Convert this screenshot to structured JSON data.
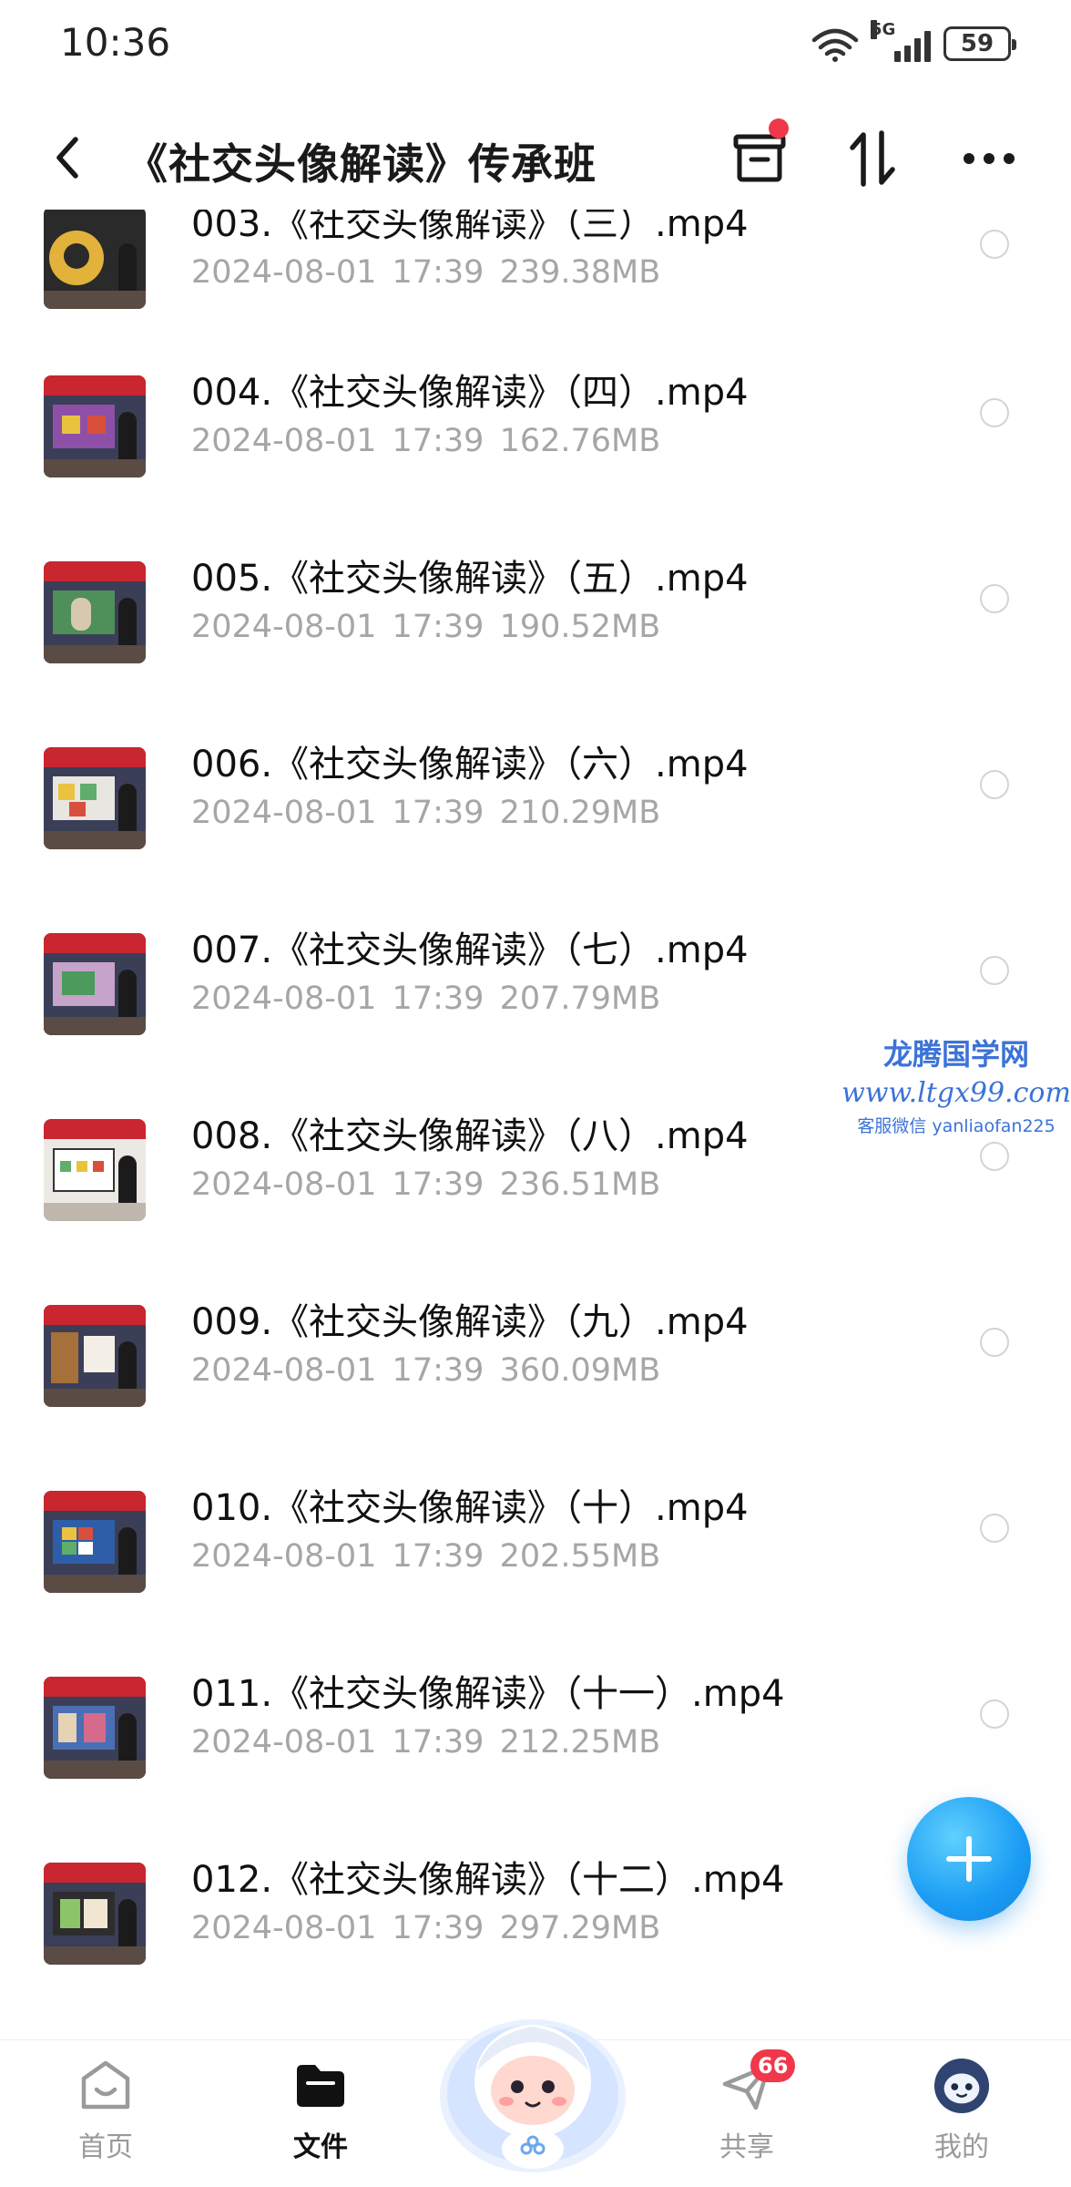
{
  "status_bar": {
    "time": "10:36",
    "network": "5G",
    "battery": "59"
  },
  "header": {
    "title": "《社交头像解读》传承班"
  },
  "files": [
    {
      "name": "003.《社交头像解读》（三）.mp4",
      "date": "2024-08-01",
      "time": "17:39",
      "size": "239.38MB"
    },
    {
      "name": "004.《社交头像解读》（四）.mp4",
      "date": "2024-08-01",
      "time": "17:39",
      "size": "162.76MB"
    },
    {
      "name": "005.《社交头像解读》（五）.mp4",
      "date": "2024-08-01",
      "time": "17:39",
      "size": "190.52MB"
    },
    {
      "name": "006.《社交头像解读》（六）.mp4",
      "date": "2024-08-01",
      "time": "17:39",
      "size": "210.29MB"
    },
    {
      "name": "007.《社交头像解读》（七）.mp4",
      "date": "2024-08-01",
      "time": "17:39",
      "size": "207.79MB"
    },
    {
      "name": "008.《社交头像解读》（八）.mp4",
      "date": "2024-08-01",
      "time": "17:39",
      "size": "236.51MB"
    },
    {
      "name": "009.《社交头像解读》（九）.mp4",
      "date": "2024-08-01",
      "time": "17:39",
      "size": "360.09MB"
    },
    {
      "name": "010.《社交头像解读》（十）.mp4",
      "date": "2024-08-01",
      "time": "17:39",
      "size": "202.55MB"
    },
    {
      "name": "011.《社交头像解读》（十一）.mp4",
      "date": "2024-08-01",
      "time": "17:39",
      "size": "212.25MB"
    },
    {
      "name": "012.《社交头像解读》（十二）.mp4",
      "date": "2024-08-01",
      "time": "17:39",
      "size": "297.29MB"
    }
  ],
  "watermark": {
    "title": "龙腾国学网",
    "url": "www.ltgx99.com",
    "contact": "客服微信 yanliaofan225"
  },
  "bottom_nav": {
    "items": [
      {
        "label": "首页"
      },
      {
        "label": "文件"
      },
      {
        "label": "共享",
        "badge": "66"
      },
      {
        "label": "我的"
      }
    ]
  },
  "colors": {
    "accent": "#1a9cf4",
    "badge": "#f0384a",
    "meta_text": "#a6a6a6",
    "watermark": "#3c73d8"
  },
  "icons": {
    "back": "chevron-left-icon",
    "archive": "archive-box-icon",
    "sort": "sort-arrows-icon",
    "more": "more-dots-icon",
    "fab": "plus-icon",
    "nav": [
      "home-smile-icon",
      "folder-icon",
      "send-icon",
      "avatar-icon"
    ]
  }
}
